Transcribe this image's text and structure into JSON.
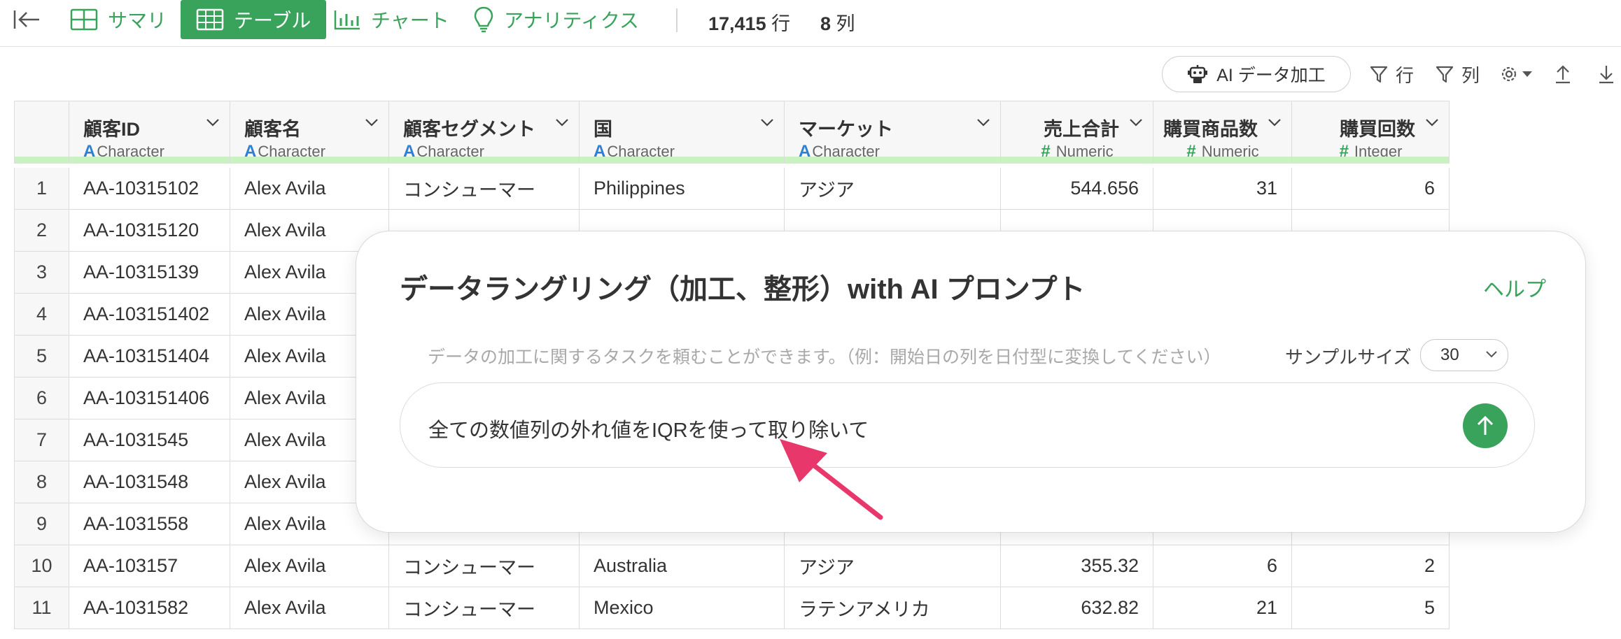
{
  "nav": {
    "tabs": [
      {
        "label": "サマリ",
        "icon": "summary-grid-icon"
      },
      {
        "label": "テーブル",
        "icon": "table-icon",
        "active": true
      },
      {
        "label": "チャート",
        "icon": "bar-chart-icon"
      },
      {
        "label": "アナリティクス",
        "icon": "lightbulb-icon"
      }
    ],
    "row_count": "17,415",
    "row_unit": "行",
    "col_count": "8",
    "col_unit": "列"
  },
  "toolbar": {
    "ai_button": "AI データ加工",
    "filter_row": "行",
    "filter_col": "列"
  },
  "columns": [
    {
      "name": "顧客ID",
      "type": "Character",
      "type_icon": "A"
    },
    {
      "name": "顧客名",
      "type": "Character",
      "type_icon": "A"
    },
    {
      "name": "顧客セグメント",
      "type": "Character",
      "type_icon": "A"
    },
    {
      "name": "国",
      "type": "Character",
      "type_icon": "A"
    },
    {
      "name": "マーケット",
      "type": "Character",
      "type_icon": "A"
    },
    {
      "name": "売上合計",
      "type": "Numeric",
      "type_icon": "#"
    },
    {
      "name": "購買商品数",
      "type": "Numeric",
      "type_icon": "#"
    },
    {
      "name": "購買回数",
      "type": "Integer",
      "type_icon": "#"
    }
  ],
  "rows": [
    {
      "n": "1",
      "cells": [
        "AA-10315102",
        "Alex Avila",
        "コンシューマー",
        "Philippines",
        "アジア",
        "544.656",
        "31",
        "6"
      ]
    },
    {
      "n": "2",
      "cells": [
        "AA-10315120",
        "Alex Avila",
        "",
        "",
        "",
        "",
        "",
        ""
      ]
    },
    {
      "n": "3",
      "cells": [
        "AA-10315139",
        "Alex Avila",
        "",
        "",
        "",
        "",
        "",
        ""
      ]
    },
    {
      "n": "4",
      "cells": [
        "AA-103151402",
        "Alex Avila",
        "",
        "",
        "",
        "",
        "",
        ""
      ]
    },
    {
      "n": "5",
      "cells": [
        "AA-103151404",
        "Alex Avila",
        "",
        "",
        "",
        "",
        "",
        ""
      ]
    },
    {
      "n": "6",
      "cells": [
        "AA-103151406",
        "Alex Avila",
        "",
        "",
        "",
        "",
        "",
        ""
      ]
    },
    {
      "n": "7",
      "cells": [
        "AA-1031545",
        "Alex Avila",
        "",
        "",
        "",
        "",
        "",
        ""
      ]
    },
    {
      "n": "8",
      "cells": [
        "AA-1031548",
        "Alex Avila",
        "",
        "",
        "",
        "",
        "",
        ""
      ]
    },
    {
      "n": "9",
      "cells": [
        "AA-1031558",
        "Alex Avila",
        "",
        "",
        "",
        "",
        "",
        ""
      ]
    },
    {
      "n": "10",
      "cells": [
        "AA-103157",
        "Alex Avila",
        "コンシューマー",
        "Australia",
        "アジア",
        "355.32",
        "6",
        "2"
      ]
    },
    {
      "n": "11",
      "cells": [
        "AA-1031582",
        "Alex Avila",
        "コンシューマー",
        "Mexico",
        "ラテンアメリカ",
        "632.82",
        "21",
        "5"
      ]
    }
  ],
  "modal": {
    "title": "データラングリング（加工、整形）with AI プロンプト",
    "help": "ヘルプ",
    "hint": "データの加工に関するタスクを頼むことができます。（例：開始日の列を日付型に変換してください）",
    "sample_label": "サンプルサイズ",
    "sample_value": "30",
    "prompt_text": "全ての数値列の外れ値をIQRを使って取り除いて"
  },
  "colors": {
    "accent": "#3aa35b",
    "type_char": "#2f7fd3",
    "bar": "#c9f1c2",
    "annotation": "#e8386b"
  }
}
